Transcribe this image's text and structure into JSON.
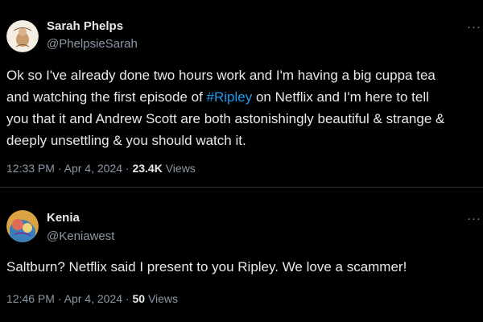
{
  "tweets": [
    {
      "display_name": "Sarah Phelps",
      "handle": "@PhelpsieSarah",
      "avatar": "avatar-illustration",
      "text_lines": [
        [
          "Ok so I've already done two hours work and I'm having a big cuppa tea"
        ],
        [
          "and watching the first episode of ",
          "#Ripley",
          " on Netflix and I'm here to tell"
        ],
        [
          "you that it and Andrew Scott are both astonishingly beautiful & strange &"
        ],
        [
          "deeply unsettling & you should watch it."
        ]
      ],
      "time": "12:33 PM",
      "separator": "·",
      "date": "Apr 4, 2024",
      "views_count": "23.4K",
      "views_label": "Views"
    },
    {
      "display_name": "Kenia",
      "handle": "@Keniawest",
      "avatar": "avatar-photo",
      "text": "Saltburn? Netflix said I present to you Ripley. We love a scammer!",
      "time": "12:46 PM",
      "separator": "·",
      "date": "Apr 4, 2024",
      "views_count": "50",
      "views_label": "Views"
    }
  ],
  "icons": {
    "more": "more-options-icon",
    "more_glyph": "···"
  },
  "colors": {
    "background": "#000000",
    "text": "#e7e9ea",
    "muted": "#8b98a5",
    "hashtag": "#1d9bf0",
    "divider": "#2f3336"
  }
}
